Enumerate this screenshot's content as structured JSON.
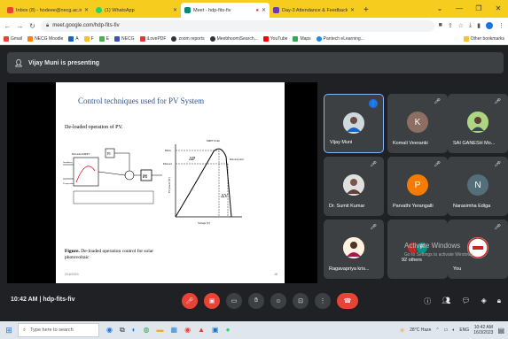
{
  "browser": {
    "tabs": [
      {
        "title": "Inbox (8) - hodeee@necg.ac.in",
        "color": "#ea4335",
        "active": false
      },
      {
        "title": "(1) WhatsApp",
        "color": "#25d366",
        "active": false
      },
      {
        "title": "Meet - hdp-fits-fiv",
        "color": "#00897b",
        "active": true
      },
      {
        "title": "Day-3 Attendance & Feedback",
        "color": "#673ab7",
        "active": false
      }
    ],
    "url": "meet.google.com/hdp-fits-fiv",
    "bookmarks": [
      "Gmail",
      "NECG Moodle",
      "A",
      "F",
      "E",
      "NECG",
      "iLovePDF",
      "zoom reports",
      "MeebhoomiSearch...",
      "YouTube",
      "Maps",
      "Pantech eLearning..."
    ],
    "other_bookmarks": "Other bookmarks"
  },
  "meet": {
    "presenting_text": "Vijay Muni is presenting",
    "meeting_code": "hdp-fits-fiv",
    "time": "10:42 AM",
    "slide": {
      "title": "Control techniques used for PV System",
      "subtitle": "De-loaded operation of PV.",
      "caption_bold": "Figure.",
      "caption": " De-loaded operation control for solar photovoltaic",
      "date": "2/16/2023",
      "page": "18",
      "labels": {
        "mppt_point": "MPPT Point",
        "deload_point": "Deload point",
        "pmax": "Pmax",
        "pdeload": "Pdeload",
        "delta_p": "ΔP",
        "delta_v": "ΔV",
        "xaxis": "Voltage (V)",
        "yaxis": "PV power (W)",
        "pi": "PI",
        "deloaded_mppt": "Deloaded MPPT",
        "irradiation": "Irradiation",
        "temperature": "Temperature"
      }
    },
    "participants": [
      {
        "name": "Vijay Muni",
        "initial": "",
        "color": "#5f6368",
        "photo": true,
        "speaking": true
      },
      {
        "name": "Komali Veeranki",
        "initial": "K",
        "color": "#8d6e63",
        "photo": false
      },
      {
        "name": "SAI GANESH Mo...",
        "initial": "",
        "color": "#5f6368",
        "photo": true
      },
      {
        "name": "Dr. Sumit Kumar",
        "initial": "",
        "color": "#5f6368",
        "photo": true
      },
      {
        "name": "Parvathi Yerangalli",
        "initial": "P",
        "color": "#f57c00",
        "photo": false
      },
      {
        "name": "Narasimha Ediga",
        "initial": "N",
        "color": "#546e7a",
        "photo": false
      },
      {
        "name": "Ragavapriya kris...",
        "initial": "",
        "color": "#5f6368",
        "photo": true
      },
      {
        "name": "92 others",
        "initial": "F",
        "color": "#009688",
        "photo": false
      },
      {
        "name": "You",
        "initial": "",
        "color": "#fff",
        "photo": false
      }
    ],
    "activate_windows": "Activate Windows",
    "activate_sub": "Go to Settings to activate Windows."
  },
  "taskbar": {
    "search_placeholder": "Type here to search",
    "weather": "28°C  Haze",
    "lang": "ENG",
    "clock_time": "10:42 AM",
    "clock_date": "16/3/2023"
  }
}
